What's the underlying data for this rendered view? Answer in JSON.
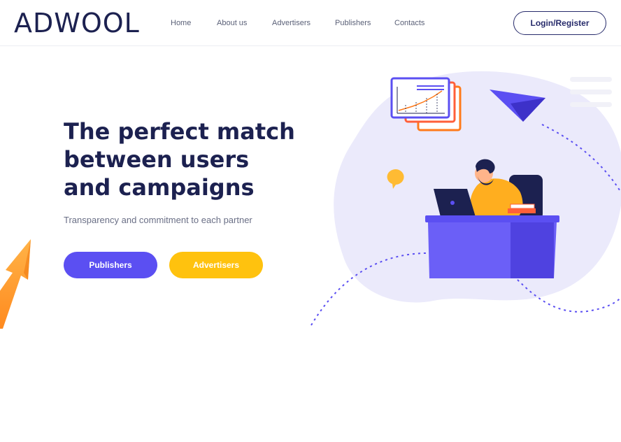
{
  "brand": {
    "logo_text": "ADWOOL"
  },
  "nav": {
    "items": [
      {
        "label": "Home"
      },
      {
        "label": "About us"
      },
      {
        "label": "Advertisers"
      },
      {
        "label": "Publishers"
      },
      {
        "label": "Contacts"
      }
    ],
    "login_label": "Login/Register"
  },
  "hero": {
    "title": "The perfect match between users and campaigns",
    "subtitle": "Transparency and commitment to each partner",
    "publishers_label": "Publishers",
    "advertisers_label": "Advertisers"
  },
  "colors": {
    "primary": "#5b4ff2",
    "accent": "#ffc20e",
    "navy": "#1c2150",
    "blob": "#ebeafb"
  }
}
